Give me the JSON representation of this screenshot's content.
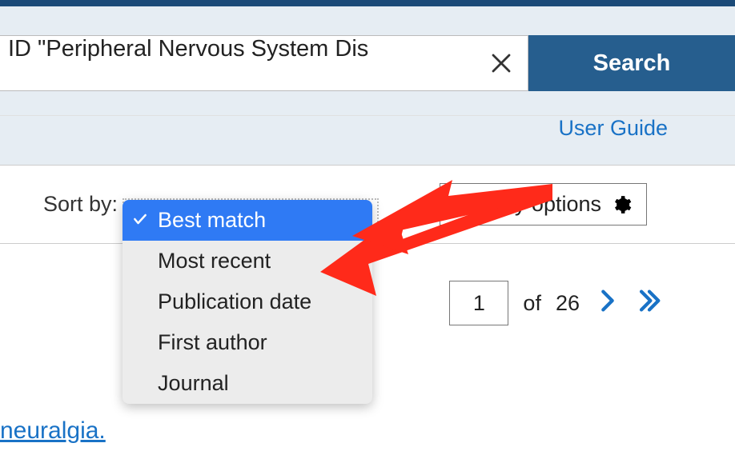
{
  "topbar": {
    "color": "#1b4a78"
  },
  "search": {
    "query_visible": "ID \"Peripheral Nervous System Dis",
    "button_label": "Search"
  },
  "user_guide_label": "User Guide",
  "sort": {
    "label": "Sort by:",
    "options": [
      "Best match",
      "Most recent",
      "Publication date",
      "First author",
      "Journal"
    ],
    "selected_index": 0
  },
  "display_options_label": "Display options",
  "pager": {
    "current_page": "1",
    "of_label": "of",
    "total_pages": "26"
  },
  "link_fragment": "neuralgia.",
  "colors": {
    "accent": "#265e8e",
    "link": "#1972c6",
    "dropdown_selected": "#2f7af4",
    "annotation_red": "#ff2a1a"
  }
}
